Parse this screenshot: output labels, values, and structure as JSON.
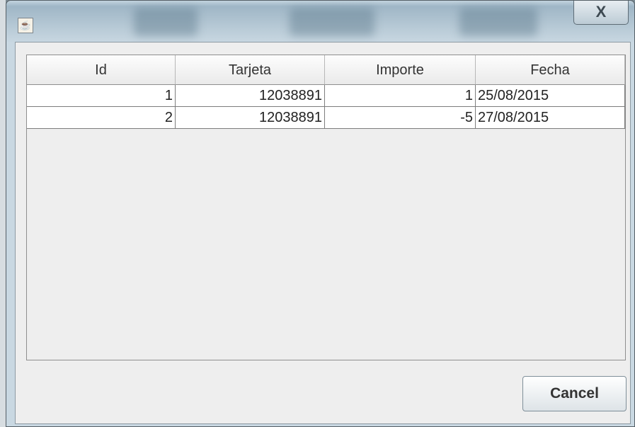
{
  "window": {
    "close_glyph": "X"
  },
  "table": {
    "columns": [
      "Id",
      "Tarjeta",
      "Importe",
      "Fecha"
    ],
    "rows": [
      [
        "1",
        "12038891",
        "1",
        "25/08/2015"
      ],
      [
        "2",
        "12038891",
        "-5",
        "27/08/2015"
      ]
    ]
  },
  "buttons": {
    "cancel_label": "Cancel"
  }
}
